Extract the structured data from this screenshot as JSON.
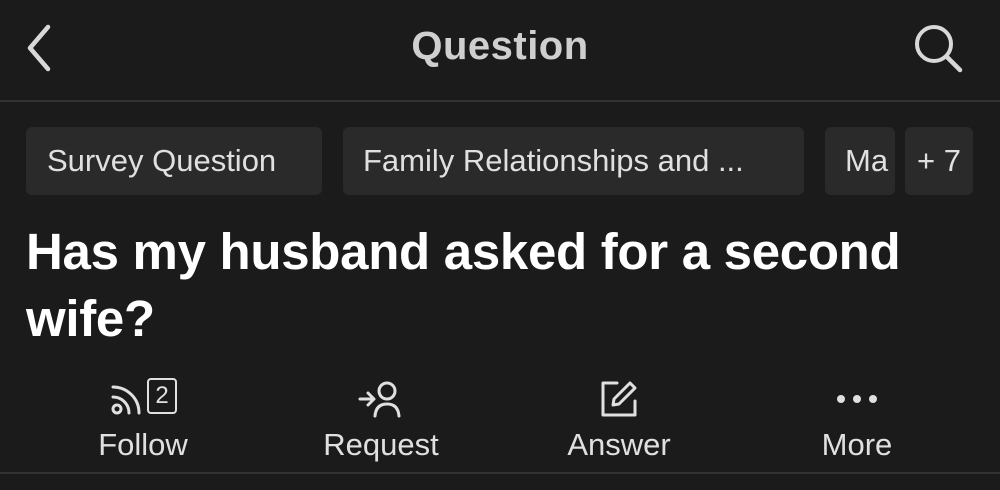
{
  "header": {
    "title": "Question",
    "back_icon": "chevron-left-icon",
    "search_icon": "search-icon"
  },
  "topics": {
    "items": [
      {
        "label": "Survey Question"
      },
      {
        "label": "Family Relationships and ..."
      },
      {
        "label": "Ma"
      }
    ],
    "more_label": "+ 7"
  },
  "question": {
    "title": "Has my husband asked for a second wife?"
  },
  "actions": {
    "follow": {
      "label": "Follow",
      "count": "2",
      "icon": "rss-feed-icon"
    },
    "request": {
      "label": "Request",
      "icon": "request-answer-icon"
    },
    "answer": {
      "label": "Answer",
      "icon": "edit-pencil-icon"
    },
    "more": {
      "label": "More",
      "icon": "more-dots-icon"
    }
  },
  "colors": {
    "background": "#1b1b1b",
    "chip_background": "#2a2a2a",
    "divider": "#333333",
    "title_text": "#ffffff",
    "body_text": "#e0e0e0"
  }
}
